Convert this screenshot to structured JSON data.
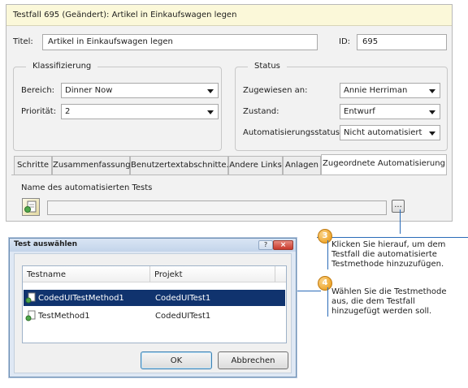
{
  "test_case": {
    "header_title": "Testfall 695 (Geändert): Artikel in Einkaufswagen legen",
    "title_label": "Titel:",
    "title_value": "Artikel in Einkaufswagen legen",
    "id_label": "ID:",
    "id_value": "695"
  },
  "classification": {
    "group_title": "Klassifizierung",
    "area_label": "Bereich:",
    "area_value": "Dinner Now",
    "priority_label": "Priorität:",
    "priority_value": "2"
  },
  "status": {
    "group_title": "Status",
    "assigned_label": "Zugewiesen an:",
    "assigned_value": "Annie Herriman",
    "state_label": "Zustand:",
    "state_value": "Entwurf",
    "automation_label": "Automatisierungsstatus:",
    "automation_value": "Nicht automatisiert"
  },
  "tabs": [
    {
      "label": "Schritte"
    },
    {
      "label": "Zusammenfassung"
    },
    {
      "label": "Benutzertextabschnitte."
    },
    {
      "label": "Andere Links"
    },
    {
      "label": "Anlagen"
    },
    {
      "label": "Zugeordnete Automatisierung"
    }
  ],
  "automation_tab": {
    "test_name_label": "Name des automatisierten Tests",
    "test_name_value": "",
    "browse_button_label": "..."
  },
  "callouts": [
    {
      "number": "3",
      "lines": [
        "Klicken Sie hierauf, um dem",
        "Testfall die automatisierte",
        "Testmethode hinzuzufügen."
      ]
    },
    {
      "number": "4",
      "lines": [
        "Wählen Sie die Testmethode",
        "aus, die dem Testfall",
        "hinzugefügt werden soll."
      ]
    }
  ],
  "dialog": {
    "title": "Test auswählen",
    "columns": [
      "Testname",
      "Projekt"
    ],
    "rows": [
      {
        "name": "CodedUITestMethod1",
        "project": "CodedUITest1",
        "selected": true
      },
      {
        "name": "TestMethod1",
        "project": "CodedUITest1",
        "selected": false
      }
    ],
    "ok_label": "OK",
    "cancel_label": "Abbrechen"
  },
  "colors": {
    "header_bg": "#fbf8d9",
    "selection": "#10336e",
    "callout_orange": "#e8940a",
    "callout_line": "#2a6cb8",
    "close_button": "#d9473d"
  }
}
